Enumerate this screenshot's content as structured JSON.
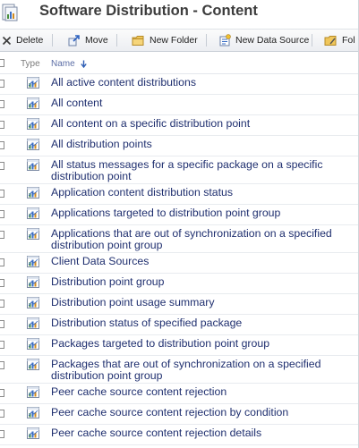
{
  "header": {
    "title": "Software Distribution - Content",
    "icon": "report-folder-icon"
  },
  "toolbar": {
    "buttons": [
      {
        "label": "Delete",
        "icon": "delete-x-icon"
      },
      {
        "label": "Move",
        "icon": "move-arrow-icon"
      },
      {
        "label": "New Folder",
        "icon": "folder-icon"
      },
      {
        "label": "New Data Source",
        "icon": "data-source-icon"
      },
      {
        "label": "Fol",
        "icon": "folder-edit-icon"
      }
    ]
  },
  "columns": {
    "type": "Type",
    "name": "Name",
    "sort": "descending-arrow"
  },
  "items": [
    {
      "label": "All active content distributions",
      "lines": 1
    },
    {
      "label": "All content",
      "lines": 1
    },
    {
      "label": "All content on a specific distribution point",
      "lines": 1
    },
    {
      "label": "All distribution points",
      "lines": 1
    },
    {
      "label": "All status messages for a specific package on a specific distribution point",
      "lines": 2
    },
    {
      "label": "Application content distribution status",
      "lines": 1
    },
    {
      "label": "Applications targeted to distribution point group",
      "lines": 1
    },
    {
      "label": "Applications that are out of synchronization on a specified distribution point group",
      "lines": 2
    },
    {
      "label": "Client Data Sources",
      "lines": 1
    },
    {
      "label": "Distribution point group",
      "lines": 1
    },
    {
      "label": "Distribution point usage summary",
      "lines": 1
    },
    {
      "label": "Distribution status of specified package",
      "lines": 1
    },
    {
      "label": "Packages targeted to distribution point group",
      "lines": 1
    },
    {
      "label": "Packages that are out of synchronization on a specified distribution point group",
      "lines": 2
    },
    {
      "label": "Peer cache source content rejection",
      "lines": 1
    },
    {
      "label": "Peer cache source content rejection by condition",
      "lines": 1
    },
    {
      "label": "Peer cache source content rejection details",
      "lines": 1
    }
  ],
  "colors": {
    "link_text": "#1f2f6f",
    "accent": "#3b6fc6"
  }
}
